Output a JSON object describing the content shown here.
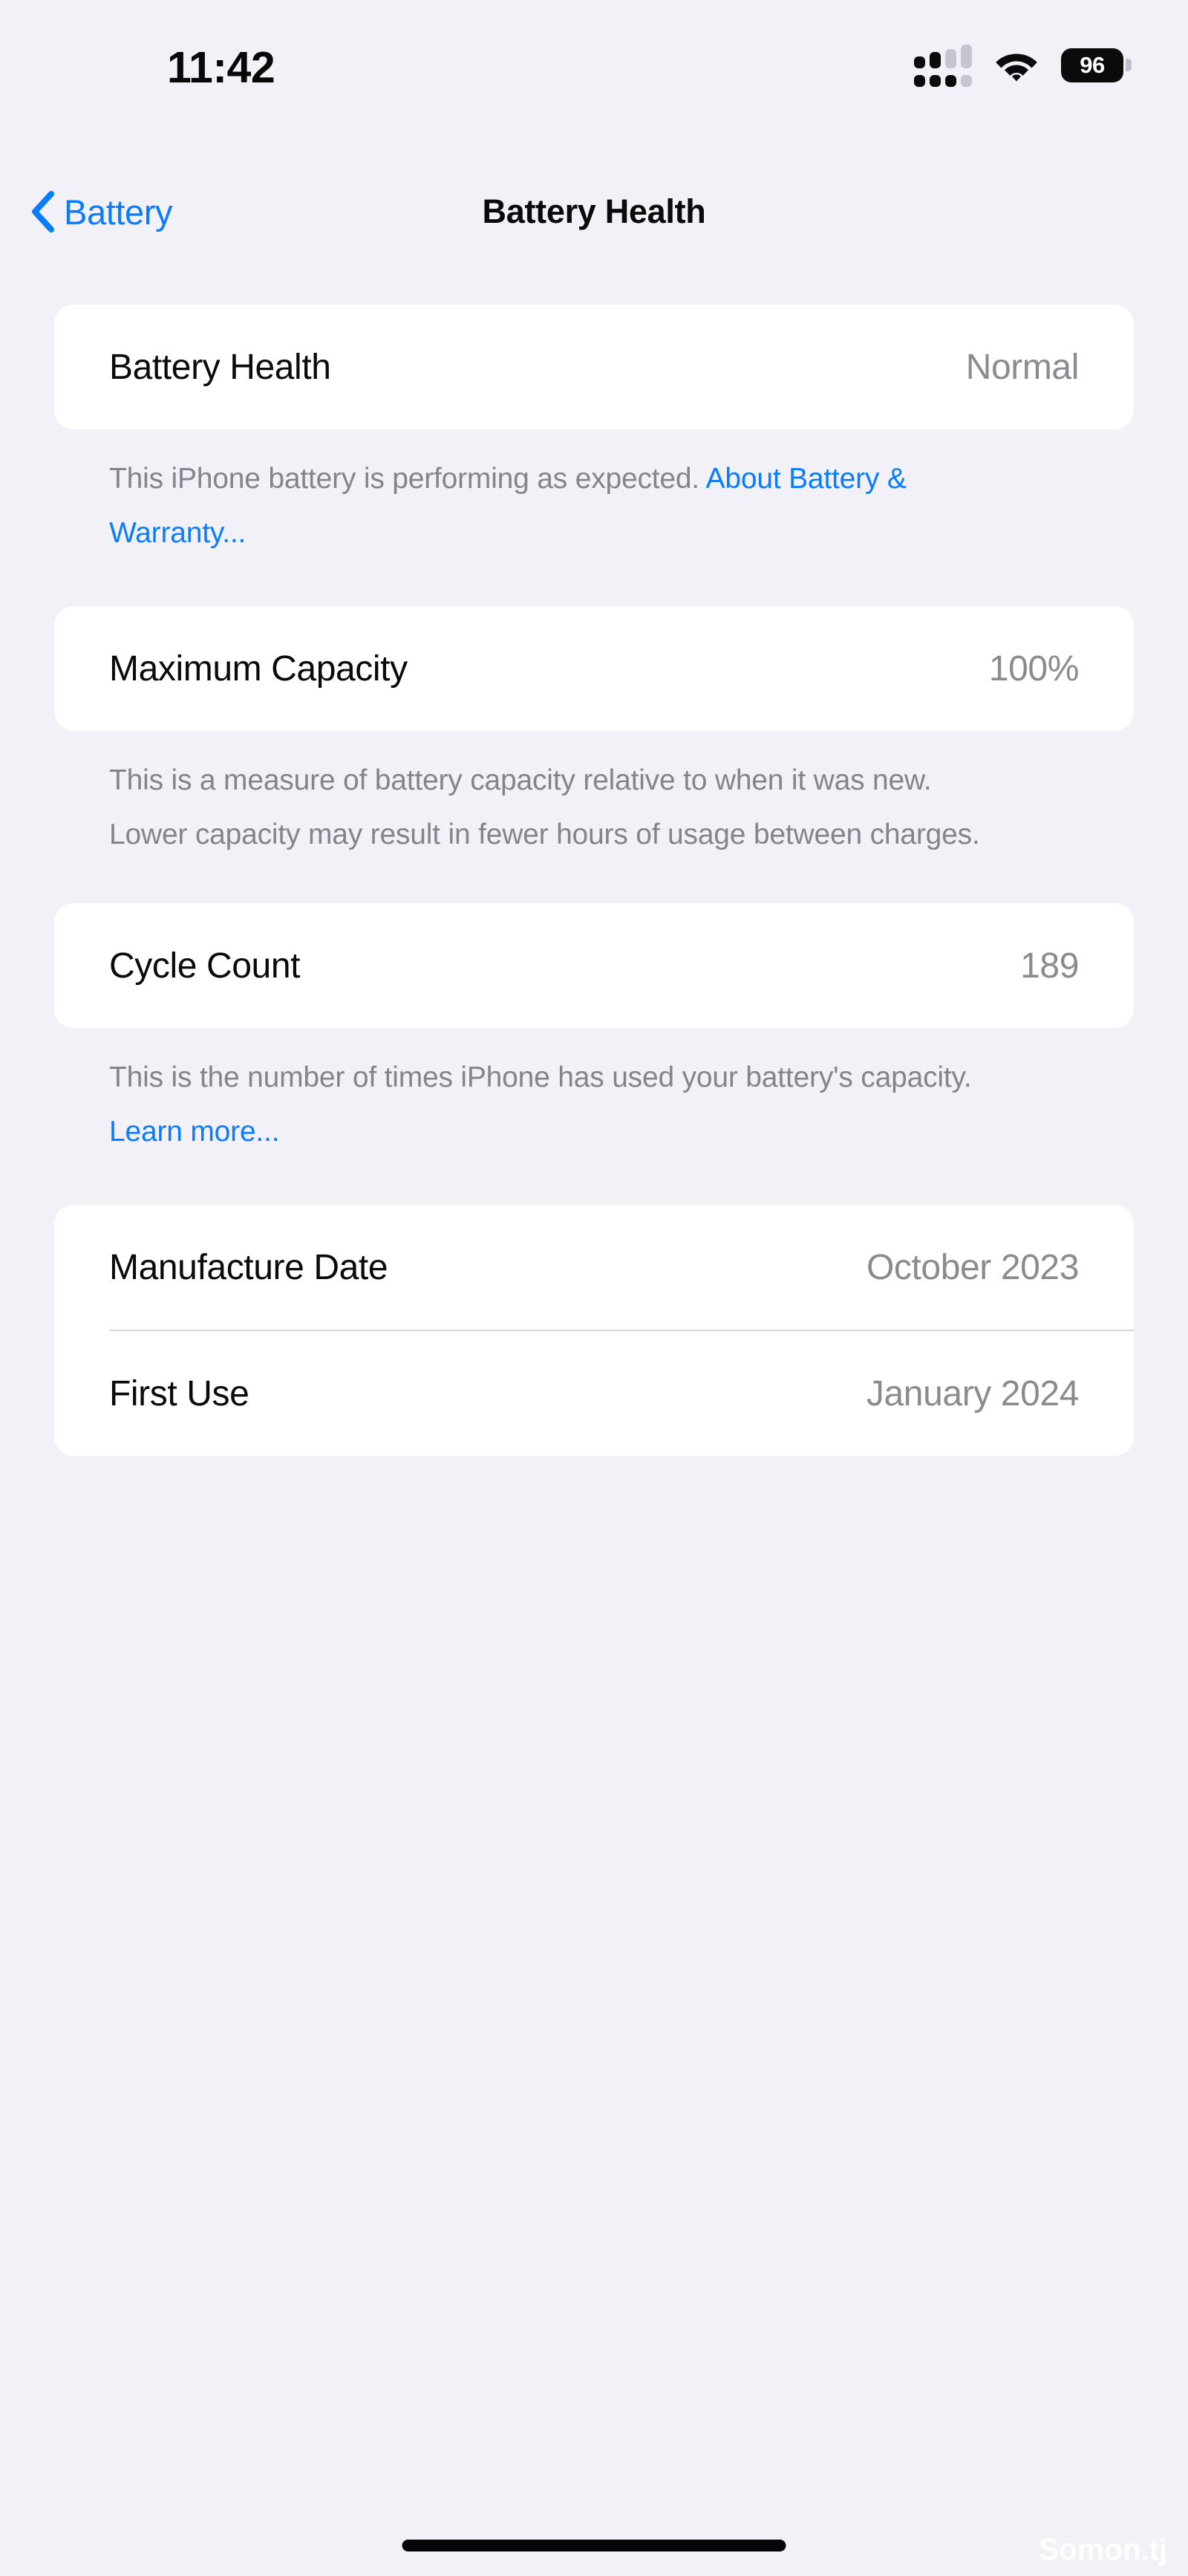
{
  "status_bar": {
    "time": "11:42",
    "cellular_icon": "cellular-signal-icon",
    "cellular_bars_top": [
      true,
      true,
      false,
      false
    ],
    "cellular_bars_bottom": [
      true,
      true,
      true,
      false
    ],
    "wifi_icon": "wifi-icon",
    "battery_icon": "battery-icon",
    "battery_level": "96"
  },
  "nav": {
    "back_icon": "chevron-left-icon",
    "back_label": "Battery",
    "title": "Battery Health"
  },
  "sections": {
    "health": {
      "row": {
        "label": "Battery Health",
        "value": "Normal"
      },
      "footer_text": "This iPhone battery is performing as expected. ",
      "footer_link": "About Battery & Warranty..."
    },
    "capacity": {
      "row": {
        "label": "Maximum Capacity",
        "value": "100%"
      },
      "footer_text": "This is a measure of battery capacity relative to when it was new. Lower capacity may result in fewer hours of usage between charges."
    },
    "cycles": {
      "row": {
        "label": "Cycle Count",
        "value": "189"
      },
      "footer_text": "This is the number of times iPhone has used your battery's capacity. ",
      "footer_link": "Learn more..."
    },
    "dates": {
      "rows": [
        {
          "label": "Manufacture Date",
          "value": "October 2023"
        },
        {
          "label": "First Use",
          "value": "January 2024"
        }
      ]
    }
  },
  "watermark": "Somon.tj",
  "colors": {
    "background": "#F1F1F7",
    "card": "#FFFFFF",
    "accent_blue": "#0A7CFF",
    "secondary_text": "#8A8A90",
    "primary_text": "#0A0A0A"
  }
}
